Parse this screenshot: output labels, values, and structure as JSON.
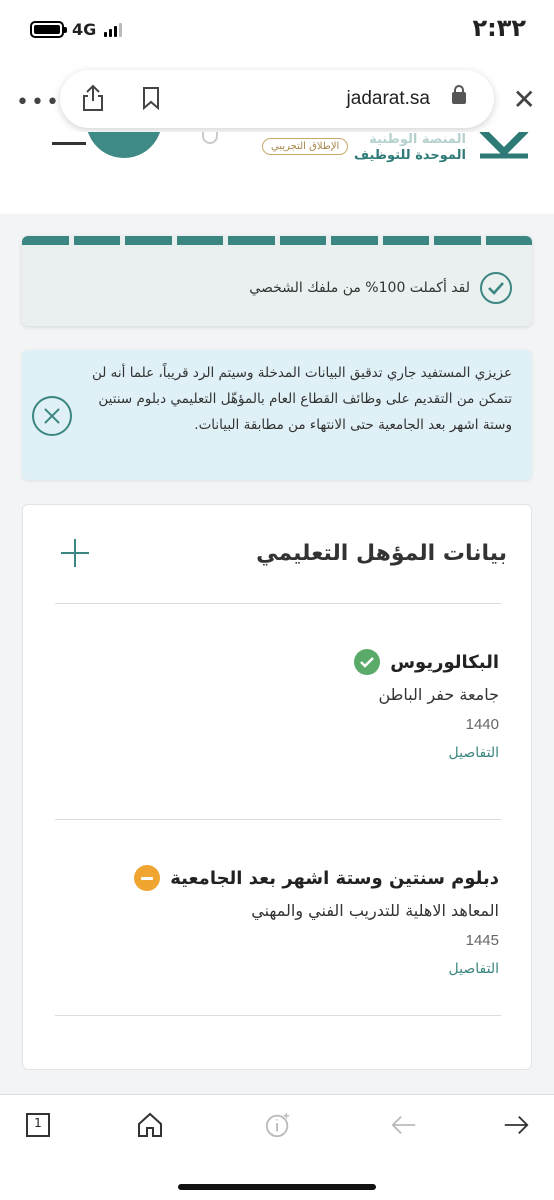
{
  "status_bar": {
    "network": "4G",
    "time": "٢:٣٢"
  },
  "browser": {
    "url": "jadarat.sa"
  },
  "site_header": {
    "beta_label": "الإطلاق التجريبي",
    "brand_line1": "المنصة الوطنية",
    "brand_line2": "الموحدة للتوظيف"
  },
  "progress": {
    "segments": 10,
    "completed_fraction": 1.0,
    "message": "لقد أكملت 100% من ملفك الشخصي"
  },
  "info": {
    "message": "عزيزي المستفيد جاري تدقيق البيانات المدخلة وسيتم الرد قريباً، علما أنه لن تتمكن من التقديم على وظائف القطاع العام بالمؤهّل التعليمي دبلوم سنتين وستة اشهر بعد الجامعية حتى الانتهاء من مطابقة البيانات."
  },
  "education": {
    "title": "بيانات المؤهل التعليمي",
    "qualifications": [
      {
        "name": "البكالوريوس",
        "status": "verified",
        "institution": "جامعة حفر الباطن",
        "year": "1440",
        "details_label": "التفاصيل"
      },
      {
        "name": "دبلوم سنتين وستة اشهر بعد الجامعية",
        "status": "pending",
        "institution": "المعاهد الاهلية للتدريب الفني والمهني",
        "year": "1445",
        "details_label": "التفاصيل"
      }
    ]
  },
  "bottom_toolbar": {
    "tab_count": "1"
  },
  "colors": {
    "accent": "#3b8681",
    "verified": "#5aab6a",
    "pending": "#f0a530",
    "info_bg": "#dff0f6"
  }
}
